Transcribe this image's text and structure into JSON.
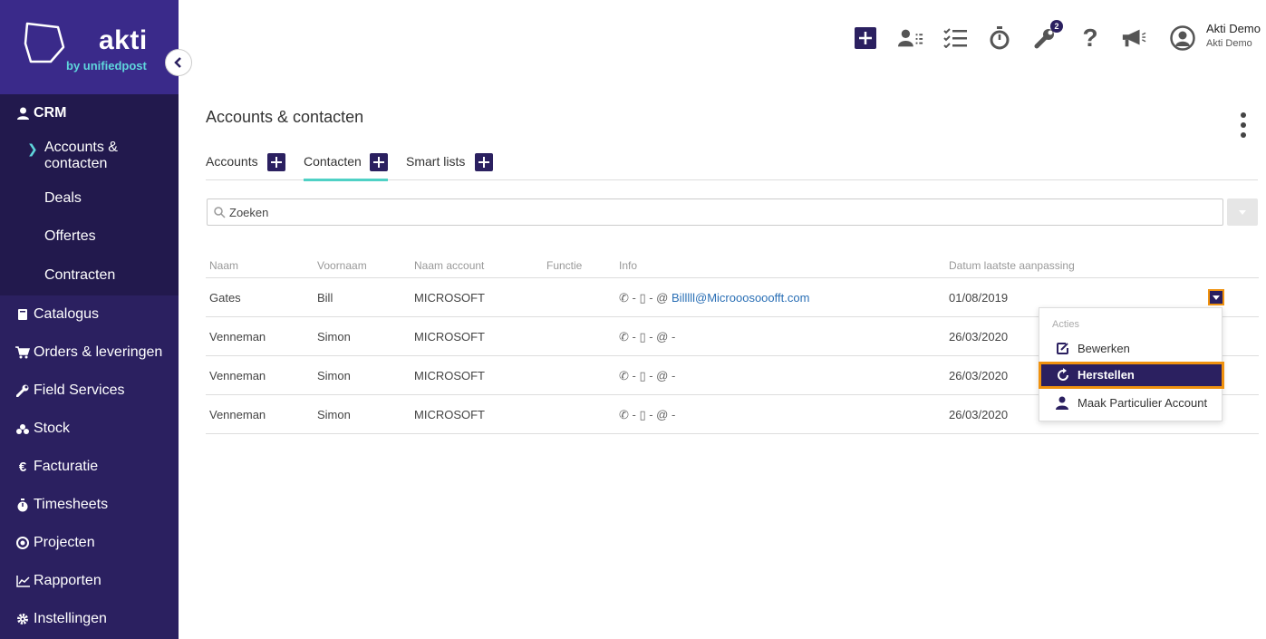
{
  "brand": {
    "name": "akti",
    "subtitle": "by unifiedpost"
  },
  "sidebar": {
    "crm_label": "CRM",
    "crm_items": [
      {
        "label": "Accounts & contacten",
        "active": true
      },
      {
        "label": "Deals"
      },
      {
        "label": "Offertes"
      },
      {
        "label": "Contracten"
      }
    ],
    "sections": [
      {
        "label": "Catalogus",
        "icon": "book-icon"
      },
      {
        "label": "Orders & leveringen",
        "icon": "cart-icon"
      },
      {
        "label": "Field Services",
        "icon": "wrench-icon"
      },
      {
        "label": "Stock",
        "icon": "boxes-icon"
      },
      {
        "label": "Facturatie",
        "icon": "euro-icon"
      },
      {
        "label": "Timesheets",
        "icon": "stopwatch-icon"
      },
      {
        "label": "Projecten",
        "icon": "target-icon"
      },
      {
        "label": "Rapporten",
        "icon": "chart-icon"
      },
      {
        "label": "Instellingen",
        "icon": "gear-icon"
      }
    ]
  },
  "topbar": {
    "notification_count": "2",
    "user_name": "Akti Demo",
    "user_company": "Akti Demo"
  },
  "page": {
    "title": "Accounts & contacten"
  },
  "tabs": [
    {
      "label": "Accounts",
      "active": false
    },
    {
      "label": "Contacten",
      "active": true
    },
    {
      "label": "Smart lists",
      "active": false
    }
  ],
  "search": {
    "placeholder": "Zoeken"
  },
  "table": {
    "headers": [
      "Naam",
      "Voornaam",
      "Naam account",
      "Functie",
      "Info",
      "Datum laatste aanpassing"
    ],
    "rows": [
      {
        "naam": "Gates",
        "voornaam": "Bill",
        "account": "MICROSOFT",
        "functie": "",
        "info_prefix": "- ▯ - @",
        "email": "Billlll@Microoosooofft.com",
        "datum": "01/08/2019"
      },
      {
        "naam": "Venneman",
        "voornaam": "Simon",
        "account": "MICROSOFT",
        "functie": "",
        "info_prefix": "- ▯ - @ -",
        "email": "",
        "datum": "26/03/2020"
      },
      {
        "naam": "Venneman",
        "voornaam": "Simon",
        "account": "MICROSOFT",
        "functie": "",
        "info_prefix": "- ▯ - @ -",
        "email": "",
        "datum": "26/03/2020"
      },
      {
        "naam": "Venneman",
        "voornaam": "Simon",
        "account": "MICROSOFT",
        "functie": "",
        "info_prefix": "- ▯ - @ -",
        "email": "",
        "datum": "26/03/2020"
      }
    ]
  },
  "actions_menu": {
    "heading": "Acties",
    "items": [
      {
        "label": "Bewerken",
        "icon": "edit-icon"
      },
      {
        "label": "Herstellen",
        "icon": "restore-icon",
        "highlighted": true
      },
      {
        "label": "Maak Particulier Account",
        "icon": "user-icon"
      }
    ]
  },
  "colors": {
    "sidebar": "#2b2060",
    "accent": "#4fd1c5",
    "highlight": "#f0920f",
    "link": "#2a6fb5"
  }
}
